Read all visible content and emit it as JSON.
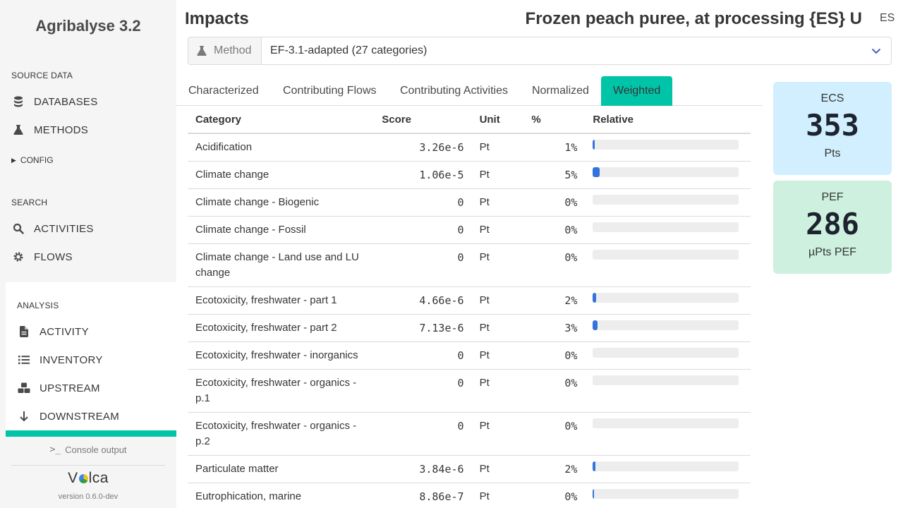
{
  "sidebar": {
    "app_title": "Agribalyse 3.2",
    "source_data_label": "SOURCE DATA",
    "source_items": [
      {
        "label": "DATABASES",
        "icon": "database-icon"
      },
      {
        "label": "METHODS",
        "icon": "flask-icon"
      }
    ],
    "config_label": "CONFIG",
    "search_label": "SEARCH",
    "search_items": [
      {
        "label": "ACTIVITIES",
        "icon": "search-icon"
      },
      {
        "label": "FLOWS",
        "icon": "cog-icon"
      }
    ],
    "analysis_label": "ANALYSIS",
    "analysis_items": [
      {
        "label": "ACTIVITY",
        "icon": "file-icon"
      },
      {
        "label": "INVENTORY",
        "icon": "list-icon"
      },
      {
        "label": "UPSTREAM",
        "icon": "cubes-icon"
      },
      {
        "label": "DOWNSTREAM",
        "icon": "arrow-down-icon"
      }
    ],
    "console_label": "Console output",
    "logo_text_a": "V",
    "logo_text_b": "lca",
    "version": "version 0.6.0-dev"
  },
  "header": {
    "title": "Impacts",
    "activity_name": "Frozen peach puree, at processing {ES} U",
    "lang": "ES"
  },
  "method": {
    "addon_label": "Method",
    "selected": "EF-3.1-adapted (27 categories)"
  },
  "tabs": [
    {
      "label": "Characterized",
      "active": false
    },
    {
      "label": "Contributing Flows",
      "active": false
    },
    {
      "label": "Contributing Activities",
      "active": false
    },
    {
      "label": "Normalized",
      "active": false
    },
    {
      "label": "Weighted",
      "active": true
    }
  ],
  "table": {
    "headers": {
      "category": "Category",
      "score": "Score",
      "unit": "Unit",
      "pct": "%",
      "relative": "Relative"
    },
    "rows": [
      {
        "category": "Acidification",
        "score": "3.26e-6",
        "unit": "Pt",
        "pct": "1%",
        "relative": 0.015
      },
      {
        "category": "Climate change",
        "score": "1.06e-5",
        "unit": "Pt",
        "pct": "5%",
        "relative": 0.048
      },
      {
        "category": "Climate change - Biogenic",
        "score": "0",
        "unit": "Pt",
        "pct": "0%",
        "relative": 0
      },
      {
        "category": "Climate change - Fossil",
        "score": "0",
        "unit": "Pt",
        "pct": "0%",
        "relative": 0
      },
      {
        "category": "Climate change - Land use and LU change",
        "score": "0",
        "unit": "Pt",
        "pct": "0%",
        "relative": 0
      },
      {
        "category": "Ecotoxicity, freshwater - part 1",
        "score": "4.66e-6",
        "unit": "Pt",
        "pct": "2%",
        "relative": 0.021
      },
      {
        "category": "Ecotoxicity, freshwater - part 2",
        "score": "7.13e-6",
        "unit": "Pt",
        "pct": "3%",
        "relative": 0.033
      },
      {
        "category": "Ecotoxicity, freshwater - inorganics",
        "score": "0",
        "unit": "Pt",
        "pct": "0%",
        "relative": 0
      },
      {
        "category": "Ecotoxicity, freshwater - organics - p.1",
        "score": "0",
        "unit": "Pt",
        "pct": "0%",
        "relative": 0
      },
      {
        "category": "Ecotoxicity, freshwater - organics - p.2",
        "score": "0",
        "unit": "Pt",
        "pct": "0%",
        "relative": 0
      },
      {
        "category": "Particulate matter",
        "score": "3.84e-6",
        "unit": "Pt",
        "pct": "2%",
        "relative": 0.018
      },
      {
        "category": "Eutrophication, marine",
        "score": "8.86e-7",
        "unit": "Pt",
        "pct": "0%",
        "relative": 0.004
      }
    ]
  },
  "cards": {
    "ecs": {
      "label": "ECS",
      "value": "353",
      "unit": "Pts"
    },
    "pef": {
      "label": "PEF",
      "value": "286",
      "unit": "µPts PEF"
    }
  },
  "colors": {
    "accent": "#00c4a7",
    "bar": "#3273dc",
    "ecs_bg": "#d1effe",
    "pef_bg": "#cdf0df"
  }
}
